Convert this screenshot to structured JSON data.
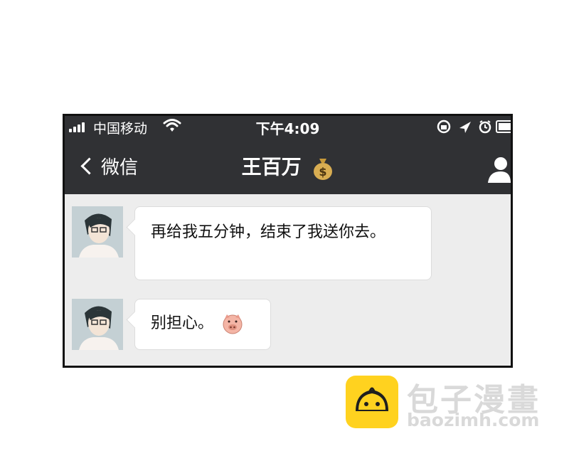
{
  "status_bar": {
    "carrier": "中国移动",
    "time": "下午4:09"
  },
  "nav": {
    "back_label": "微信",
    "title": "王百万",
    "title_emoji": "money-bag-icon"
  },
  "messages": [
    {
      "sender": "contact",
      "text": "再给我五分钟，结束了我送你去。"
    },
    {
      "sender": "contact",
      "text": "别担心。",
      "emoji": "pig-face-icon"
    }
  ],
  "watermark": {
    "brand": "包子漫畫",
    "url": "baozimh.com"
  },
  "colors": {
    "header_bg": "#303134",
    "chat_bg": "#ededed",
    "bubble_bg": "#ffffff",
    "logo_yellow": "#ffd21f"
  }
}
